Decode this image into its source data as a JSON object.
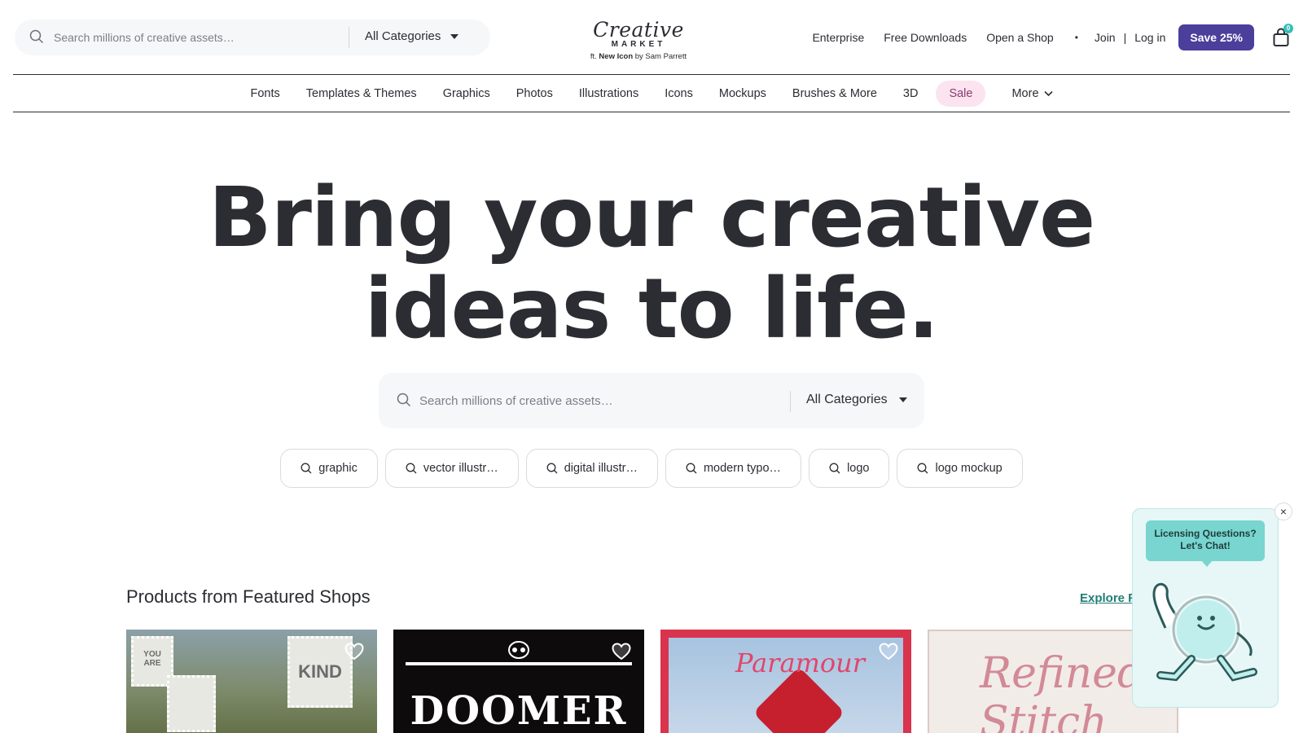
{
  "header": {
    "search_placeholder": "Search millions of creative assets…",
    "category_label": "All Categories",
    "logo": {
      "script": "Creative",
      "market": "MARKET",
      "credit_prefix": "ft. ",
      "credit_bold": "New Icon",
      "credit_suffix": " by Sam Parrett"
    },
    "nav": {
      "enterprise": "Enterprise",
      "free_downloads": "Free Downloads",
      "open_shop": "Open a Shop",
      "dot": "•",
      "join": "Join",
      "separator": "|",
      "login": "Log in",
      "save_button": "Save 25%",
      "cart_count": "0"
    },
    "accent_color": "#4a3f9a"
  },
  "categories": {
    "fonts": "Fonts",
    "templates": "Templates & Themes",
    "graphics": "Graphics",
    "photos": "Photos",
    "illustrations": "Illustrations",
    "icons": "Icons",
    "mockups": "Mockups",
    "brushes": "Brushes & More",
    "three_d": "3D",
    "sale": "Sale",
    "more": "More"
  },
  "hero": {
    "line1": "Bring your creative",
    "line2": "ideas to life.",
    "search_placeholder": "Search millions of creative assets…",
    "category_label": "All Categories"
  },
  "suggestions": [
    "graphic",
    "vector illustr…",
    "digital illustr…",
    "modern typo…",
    "logo",
    "logo mockup"
  ],
  "featured": {
    "title": "Products from Featured Shops",
    "explore_link": "Explore F",
    "cards": {
      "card1_lace_1": "YOU\nARE",
      "card1_lace_2": "KIND",
      "card2_title": "DOOMER",
      "card3_title": "Paramour",
      "card4_title": "Refined\nStitch"
    }
  },
  "chat": {
    "close": "×",
    "bubble_line1": "Licensing Questions?",
    "bubble_line2": "Let's Chat!"
  }
}
